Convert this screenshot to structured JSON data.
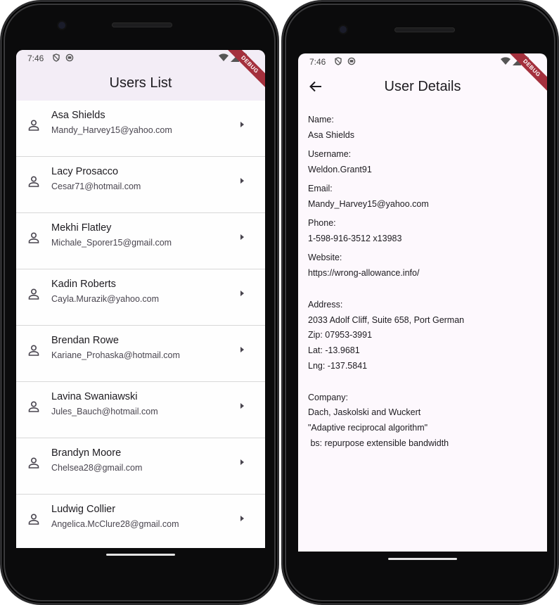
{
  "left_screen": {
    "status": {
      "time": "7:46"
    },
    "debug_banner": "DEBUG",
    "title": "Users List",
    "users": [
      {
        "name": "Asa Shields",
        "email": "Mandy_Harvey15@yahoo.com"
      },
      {
        "name": "Lacy Prosacco",
        "email": "Cesar71@hotmail.com"
      },
      {
        "name": "Mekhi Flatley",
        "email": "Michale_Sporer15@gmail.com"
      },
      {
        "name": "Kadin Roberts",
        "email": "Cayla.Murazik@yahoo.com"
      },
      {
        "name": "Brendan Rowe",
        "email": "Kariane_Prohaska@hotmail.com"
      },
      {
        "name": "Lavina Swaniawski",
        "email": "Jules_Bauch@hotmail.com"
      },
      {
        "name": "Brandyn Moore",
        "email": "Chelsea28@gmail.com"
      },
      {
        "name": "Ludwig Collier",
        "email": "Angelica.McClure28@gmail.com"
      }
    ],
    "icons": {
      "item_leading": "person-outline-icon",
      "item_trailing": "arrow-right-icon"
    }
  },
  "right_screen": {
    "status": {
      "time": "7:46"
    },
    "debug_banner": "DEBUG",
    "title": "User Details",
    "back_icon": "arrow-back-icon",
    "details": {
      "name_label": "Name:",
      "name_value": "Asa Shields",
      "username_label": "Username:",
      "username_value": "Weldon.Grant91",
      "email_label": "Email:",
      "email_value": "Mandy_Harvey15@yahoo.com",
      "phone_label": "Phone:",
      "phone_value": "1-598-916-3512 x13983",
      "website_label": "Website:",
      "website_value": "https://wrong-allowance.info/",
      "address_label": "Address:",
      "address_street": "2033 Adolf Cliff, Suite 658, Port German",
      "address_zip": "Zip: 07953-3991",
      "address_lat": "Lat: -13.9681",
      "address_lng": "Lng: -137.5841",
      "company_label": "Company:",
      "company_name": "Dach, Jaskolski and Wuckert",
      "company_catchphrase": "\"Adaptive reciprocal algorithm\"",
      "company_bs": " bs: repurpose extensible bandwidth"
    }
  },
  "colors": {
    "appbar_bg": "#f3edf6",
    "screen_bg": "#fef7ff",
    "debug_banner": "#a4303d",
    "divider": "#d8d8d8"
  }
}
